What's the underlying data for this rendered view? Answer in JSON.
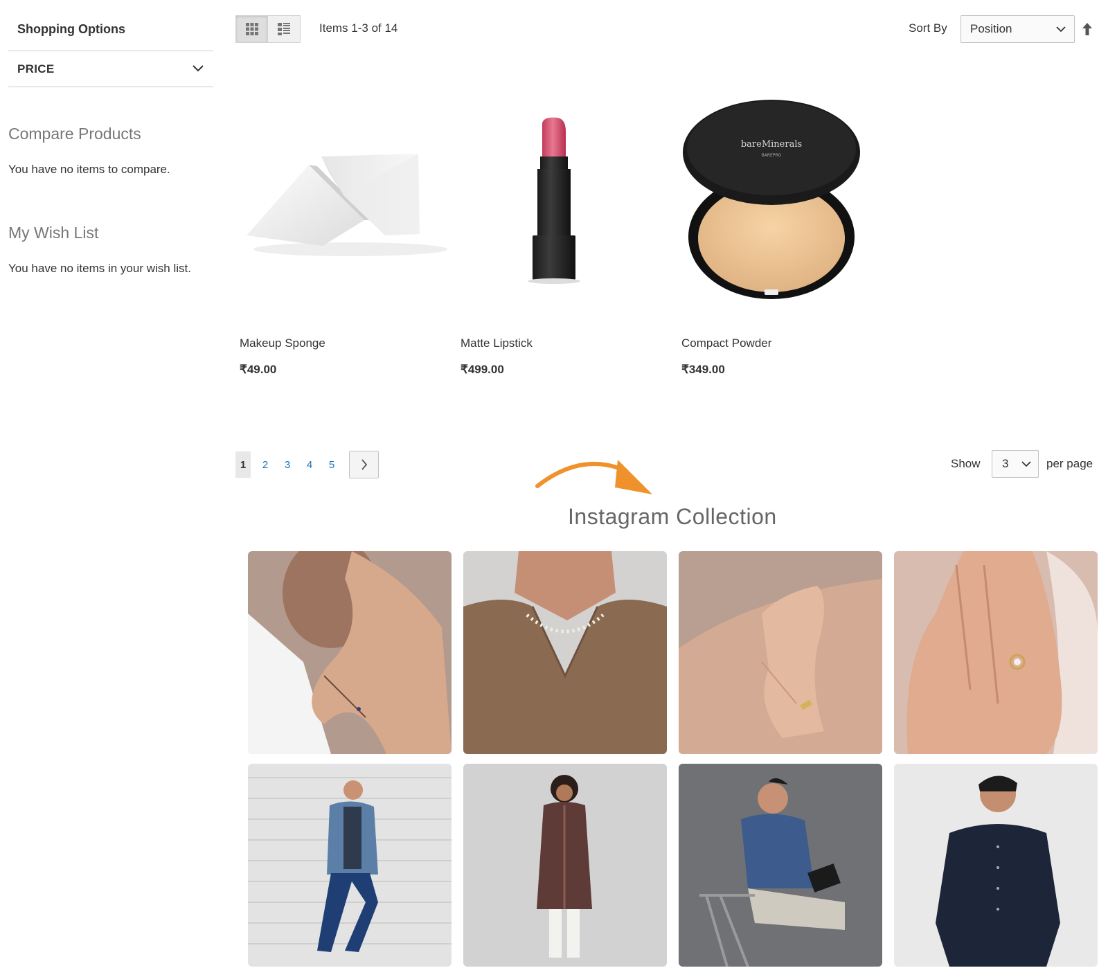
{
  "sidebar": {
    "shopping_options": "Shopping Options",
    "filter_price": "PRICE",
    "compare_title": "Compare Products",
    "compare_text": "You have no items to compare.",
    "wishlist_title": "My Wish List",
    "wishlist_text": "You have no items in your wish list."
  },
  "toolbar": {
    "amount": "Items 1-3 of 14",
    "sort_label": "Sort By",
    "sort_value": "Position",
    "view_modes": [
      "grid-icon",
      "list-icon"
    ]
  },
  "products": [
    {
      "name": "Makeup Sponge",
      "price": "₹49.00"
    },
    {
      "name": "Matte Lipstick",
      "price": "₹499.00"
    },
    {
      "name": "Compact Powder",
      "price": "₹349.00"
    }
  ],
  "compact_brand": "bareMinerals",
  "compact_sub": "BAREPRO",
  "pagination": {
    "current": "1",
    "pages": [
      "2",
      "3",
      "4",
      "5"
    ],
    "show_label": "Show",
    "limit_value": "3",
    "per_page_label": "per page"
  },
  "instagram": {
    "title": "Instagram Collection",
    "arrow_color": "#f0922b"
  }
}
